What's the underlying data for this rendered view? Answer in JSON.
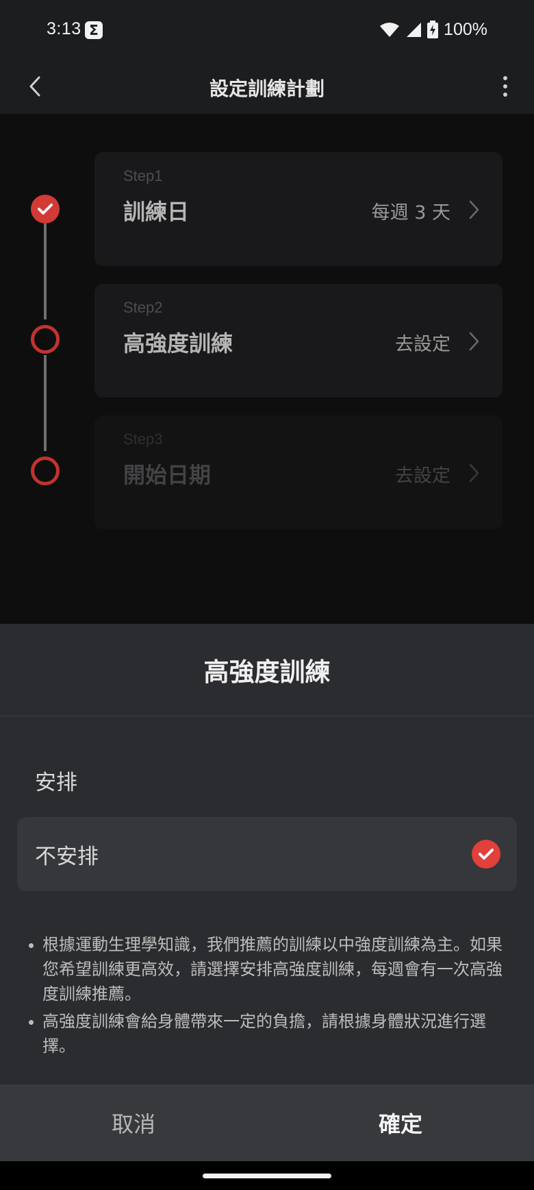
{
  "status_bar": {
    "time": "3:13",
    "app_icon_glyph": "Σ",
    "battery_percent": "100%",
    "icons": [
      "wifi-icon",
      "cell-signal-icon",
      "battery-charging-icon"
    ]
  },
  "app_bar": {
    "title": "設定訓練計劃",
    "back_icon": "chevron-left-icon",
    "more_icon": "more-vert-icon"
  },
  "steps": [
    {
      "label": "Step1",
      "name": "訓練日",
      "value": "每週 3 天",
      "status": "done"
    },
    {
      "label": "Step2",
      "name": "高強度訓練",
      "value": "去設定",
      "status": "todo"
    },
    {
      "label": "Step3",
      "name": "開始日期",
      "value": "去設定",
      "status": "disabled"
    }
  ],
  "sheet": {
    "title": "高強度訓練",
    "options": [
      {
        "label": "安排",
        "selected": false
      },
      {
        "label": "不安排",
        "selected": true
      }
    ],
    "notes": [
      "根據運動生理學知識，我們推薦的訓練以中強度訓練為主。如果您希望訓練更高效，請選擇安排高強度訓練，每週會有一次高強度訓練推薦。",
      "高強度訓練會給身體帶來一定的負擔，請根據身體狀況進行選擇。"
    ],
    "cancel_label": "取消",
    "confirm_label": "確定"
  },
  "colors": {
    "accent": "#e1403b",
    "sheet_bg": "#2b2c2f",
    "button_bar_bg": "#38393c"
  }
}
